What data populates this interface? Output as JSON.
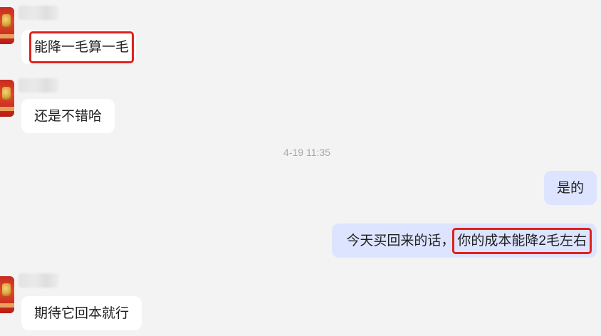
{
  "messages": [
    {
      "from": "other",
      "text": "能降一毛算一毛",
      "highlighted": true
    },
    {
      "from": "other",
      "text": "还是不错哈",
      "highlighted": false
    },
    {
      "from": "me",
      "text": "是的"
    },
    {
      "from": "me",
      "prefix": "今天买回来的话，",
      "highlight_text": "你的成本能降2毛左右"
    },
    {
      "from": "other",
      "text": "期待它回本就行",
      "highlighted": false
    }
  ],
  "timestamp": "4-19 11:35",
  "colors": {
    "background": "#f3f3f3",
    "incoming_bubble": "#ffffff",
    "outgoing_bubble": "#dde4ff",
    "highlight_box": "#e0201c",
    "timestamp_text": "#a8a8a8"
  }
}
